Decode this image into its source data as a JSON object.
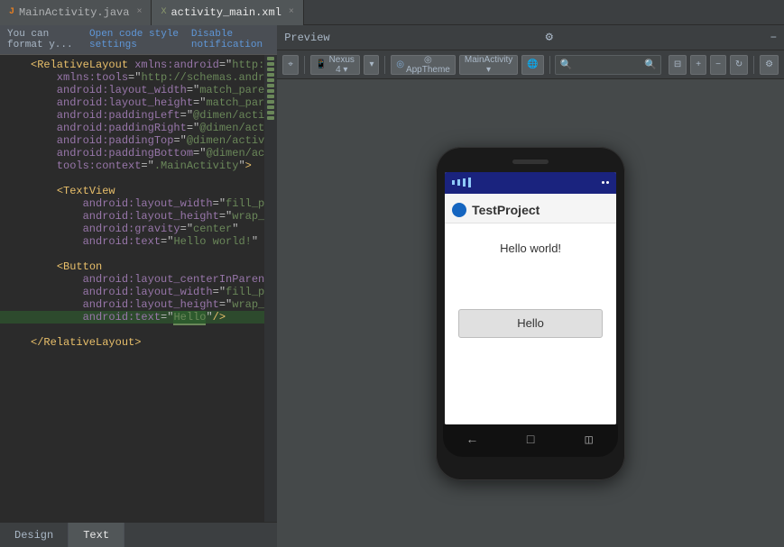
{
  "tabs": [
    {
      "id": "main-java",
      "label": "MainActivity.java",
      "type": "java",
      "active": false
    },
    {
      "id": "activity-xml",
      "label": "activity_main.xml",
      "type": "xml",
      "active": true
    }
  ],
  "notification": {
    "text": "You can format y...",
    "link1": "Open code style settings",
    "link2": "Disable notification"
  },
  "code_lines": [
    {
      "num": "",
      "text": "<RelativeLayout xmlns:android=\"http://schemas.andro",
      "type": "tag_open"
    },
    {
      "num": "",
      "text": "    xmlns:tools=\"http://schemas.android.com/tools\"",
      "type": "attr"
    },
    {
      "num": "",
      "text": "    android:layout_width=\"match_parent\"",
      "type": "attr"
    },
    {
      "num": "",
      "text": "    android:layout_height=\"match_parent\"",
      "type": "attr"
    },
    {
      "num": "",
      "text": "    android:paddingLeft=\"@dimen/activity_horizontal",
      "type": "attr"
    },
    {
      "num": "",
      "text": "    android:paddingRight=\"@dimen/activity_horizonta",
      "type": "attr"
    },
    {
      "num": "",
      "text": "    android:paddingTop=\"@dimen/activity_vertical_ma",
      "type": "attr"
    },
    {
      "num": "",
      "text": "    android:paddingBottom=\"@dimen/activity_vertical",
      "type": "attr"
    },
    {
      "num": "",
      "text": "    tools:context=\".MainActivity\">",
      "type": "attr_close"
    },
    {
      "num": "",
      "text": "",
      "type": "empty"
    },
    {
      "num": "",
      "text": "    <TextView",
      "type": "tag_inner"
    },
    {
      "num": "",
      "text": "        android:layout_width=\"fill_parent\"",
      "type": "attr"
    },
    {
      "num": "",
      "text": "        android:layout_height=\"wrap_content\"",
      "type": "attr"
    },
    {
      "num": "",
      "text": "        android:gravity=\"center\"",
      "type": "attr"
    },
    {
      "num": "",
      "text": "        android:text=\"Hello world!\" />",
      "type": "attr_close"
    },
    {
      "num": "",
      "text": "",
      "type": "empty"
    },
    {
      "num": "",
      "text": "    <Button",
      "type": "tag_inner"
    },
    {
      "num": "",
      "text": "        android:layout_centerInParent=\"true\"",
      "type": "attr"
    },
    {
      "num": "",
      "text": "        android:layout_width=\"fill_parent\"",
      "type": "attr"
    },
    {
      "num": "",
      "text": "        android:layout_height=\"wrap_content\"",
      "type": "attr"
    },
    {
      "num": "",
      "text": "        android:text=\"Hello\"/>",
      "type": "attr_highlight"
    },
    {
      "num": "",
      "text": "",
      "type": "empty"
    },
    {
      "num": "",
      "text": "</RelativeLayout>",
      "type": "tag_close"
    }
  ],
  "preview": {
    "title": "Preview",
    "gear_icon": "⚙",
    "toolbar": {
      "btn1": "⌖",
      "btn2": "Nexus 4 ▾",
      "btn3": "▾",
      "btn4": "◎ AppTheme",
      "btn5": "MainActivity ▾",
      "btn6": "🌐 ▾",
      "btn7": "□"
    },
    "phone": {
      "app_title": "TestProject",
      "hello_world": "Hello world!",
      "button_label": "Hello"
    }
  },
  "bottom_tabs": [
    {
      "label": "Design",
      "active": false
    },
    {
      "label": "Text",
      "active": true
    }
  ],
  "strip_dots": [
    1,
    2,
    3,
    4,
    5,
    6,
    7,
    8,
    9,
    10,
    11,
    12,
    13,
    14
  ]
}
